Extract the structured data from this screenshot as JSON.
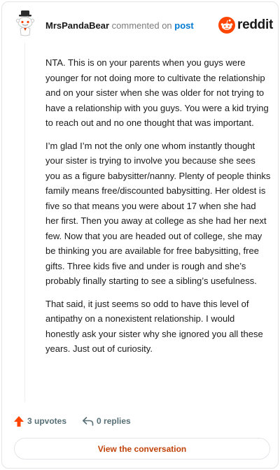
{
  "comment": {
    "author": "MrsPandaBear",
    "action_text": "commented on",
    "post_link": "post",
    "paragraphs": [
      "NTA. This is on your parents when you guys were younger for not doing more to cultivate the relationship and on your sister when she was older for not trying to have a relationship with you guys. You were a kid trying to reach out and no one thought that was important.",
      "I’m glad I’m not the only one whom instantly thought your sister is trying to involve you because she sees you as a figure babysitter/nanny. Plenty of people thinks family means free/discounted babysitting. Her oldest is five so that means you were about 17 when she had her first. Then you away at college as she had her next few. Now that you are headed out of college, she may be thinking you are available for free babysitting, free gifts. Three kids five and under is rough and she’s probably finally starting to see a sibling’s usefulness.",
      "That said, it just seems so odd to have this level of antipathy on a nonexistent relationship. I would honestly ask your sister why she ignored you all these years. Just out of curiosity."
    ],
    "upvotes": "3 upvotes",
    "replies": "0 replies"
  },
  "brand": {
    "wordmark": "reddit",
    "accent": "#ff4500"
  },
  "cta": {
    "label": "View the conversation"
  },
  "icons": [
    "avatar-snoo-icon",
    "reddit-logo-icon",
    "upvote-arrow-icon",
    "reply-arrow-icon"
  ]
}
